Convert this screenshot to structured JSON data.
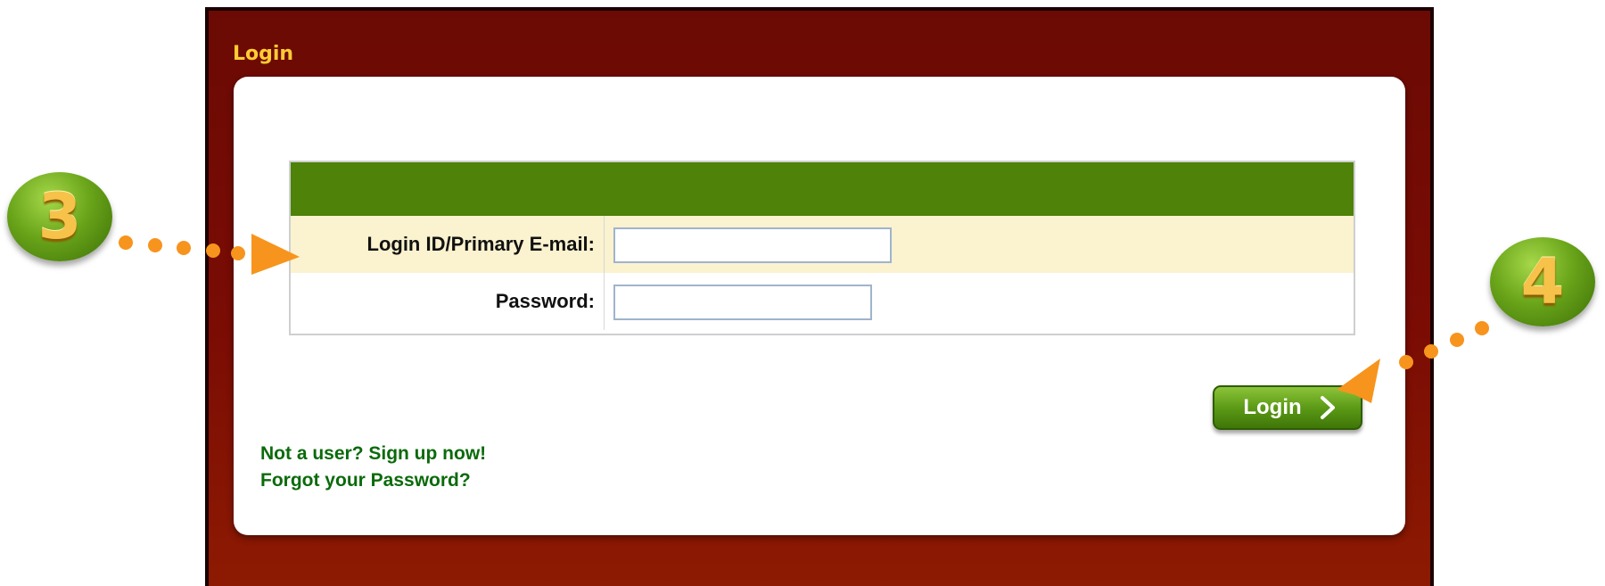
{
  "window": {
    "title": "Login"
  },
  "form": {
    "email_label": "Login ID/Primary E-mail:",
    "email_value": "",
    "password_label": "Password:",
    "password_value": ""
  },
  "actions": {
    "login_label": "Login"
  },
  "links": {
    "signup": "Not a user? Sign up now!",
    "forgot_password": "Forgot your Password?"
  },
  "annotations": {
    "step_3": "3",
    "step_4": "4"
  },
  "colors": {
    "panel": "#7a0c04",
    "title": "#ffcc33",
    "form_header": "#4e8208",
    "row_highlight": "#fbf2cf",
    "link": "#0b6a0b",
    "arrow": "#f7941d"
  },
  "icons": {
    "login_button": "chevron-right-icon"
  }
}
